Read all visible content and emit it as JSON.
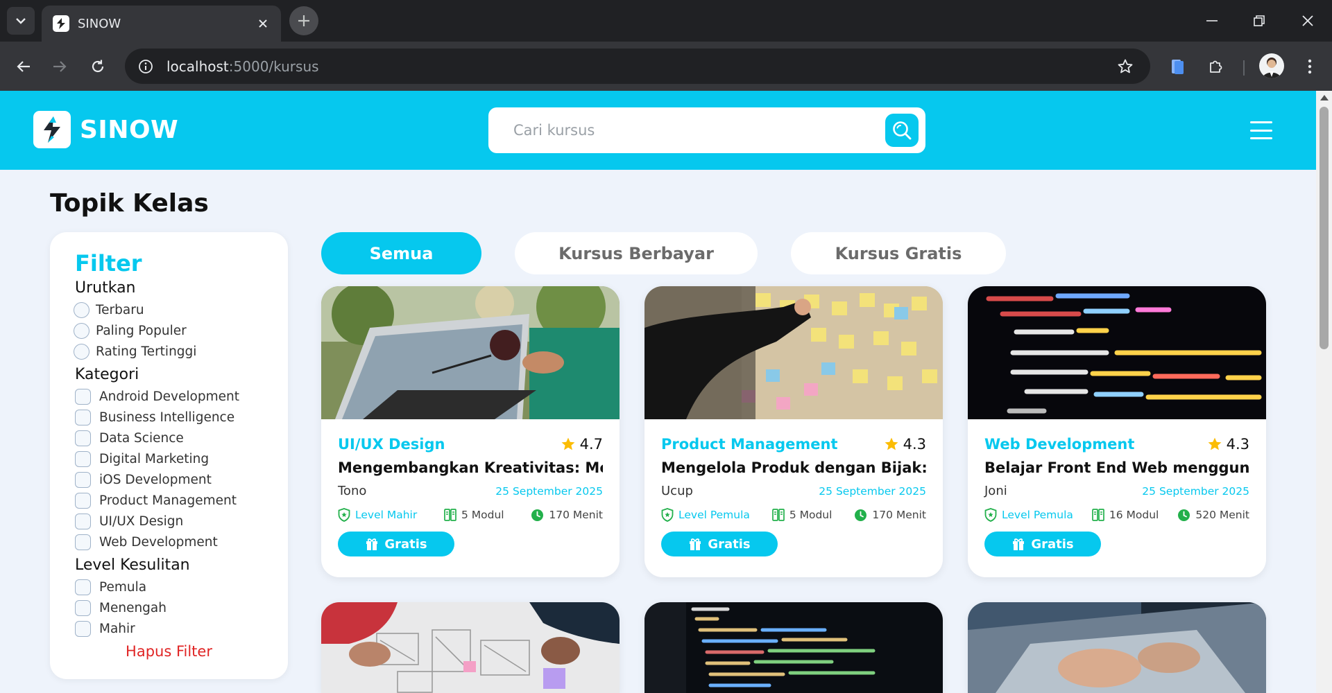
{
  "browser": {
    "tab_title": "SINOW",
    "url_host": "localhost",
    "url_path": ":5000/kursus"
  },
  "header": {
    "brand": "SINOW",
    "search_placeholder": "Cari kursus"
  },
  "page": {
    "title": "Topik Kelas"
  },
  "filter": {
    "title": "Filter",
    "sort_label": "Urutkan",
    "sort_options": [
      "Terbaru",
      "Paling Populer",
      "Rating Tertinggi"
    ],
    "category_label": "Kategori",
    "categories": [
      "Android Development",
      "Business Intelligence",
      "Data Science",
      "Digital Marketing",
      "iOS Development",
      "Product Management",
      "UI/UX Design",
      "Web Development"
    ],
    "level_label": "Level Kesulitan",
    "levels": [
      "Pemula",
      "Menengah",
      "Mahir"
    ],
    "clear": "Hapus Filter"
  },
  "tabs": [
    {
      "label": "Semua",
      "active": true
    },
    {
      "label": "Kursus Berbayar",
      "active": false
    },
    {
      "label": "Kursus Gratis",
      "active": false
    }
  ],
  "courses": [
    {
      "category": "UI/UX Design",
      "rating": "4.7",
      "title": "Mengembangkan Kreativitas: Me...",
      "author": "Tono",
      "date": "25 September 2025",
      "level": "Level Mahir",
      "modules": "5 Modul",
      "duration": "170 Menit",
      "price_label": "Gratis",
      "image": "laptop-coffee-photo"
    },
    {
      "category": "Product Management",
      "rating": "4.3",
      "title": "Mengelola Produk dengan Bijak: ...",
      "author": "Ucup",
      "date": "25 September 2025",
      "level": "Level Pemula",
      "modules": "5 Modul",
      "duration": "170 Menit",
      "price_label": "Gratis",
      "image": "sticky-notes-board-photo"
    },
    {
      "category": "Web Development",
      "rating": "4.3",
      "title": "Belajar Front End Web menggun...",
      "author": "Joni",
      "date": "25 September 2025",
      "level": "Level Pemula",
      "modules": "16 Modul",
      "duration": "520 Menit",
      "price_label": "Gratis",
      "image": "code-screen-photo"
    }
  ],
  "colors": {
    "accent": "#06c8ee",
    "danger": "#e02424",
    "page_bg": "#eef3fb"
  }
}
